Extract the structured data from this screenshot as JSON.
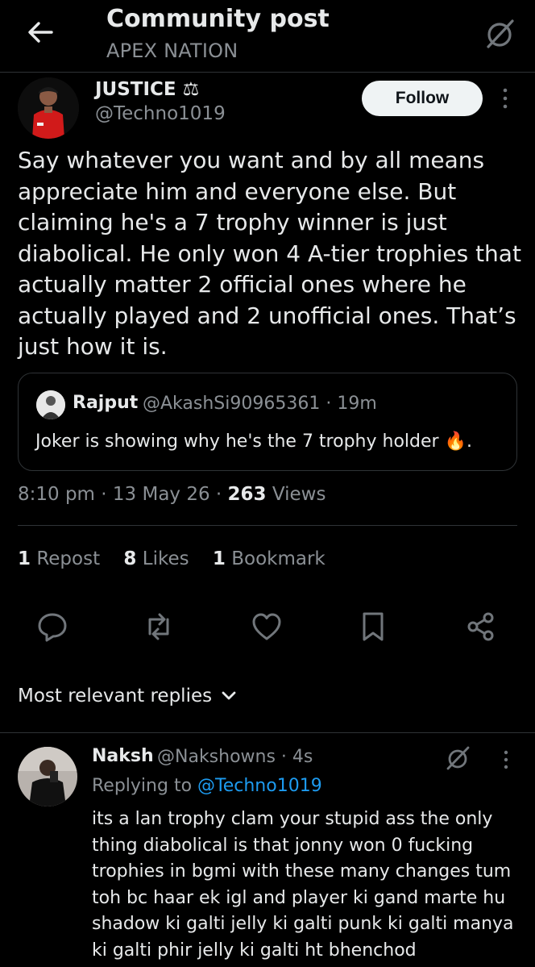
{
  "header": {
    "title": "Community post",
    "subtitle": "APEX NATION"
  },
  "post": {
    "author_name": "JUSTICE ⚖",
    "author_handle": "@Techno1019",
    "follow_label": "Follow",
    "text": "Say whatever you want and by all means appreciate him and everyone else. But claiming he's a 7 trophy winner is just diabolical. He only won 4 A-tier trophies that actually matter 2 official ones where he actually played and 2 unofficial ones. That’s just how it is.",
    "quote": {
      "name": "Rajput",
      "meta": "@AkashSi90965361 · 19m",
      "text": "Joker is showing why he's the 7 trophy holder 🔥."
    },
    "time": "8:10 pm · 13 May 26 · ",
    "views_count": "263",
    "views_label": " Views",
    "stats": {
      "reposts_count": "1",
      "reposts_label": " Repost",
      "likes_count": "8",
      "likes_label": " Likes",
      "bookmarks_count": "1",
      "bookmarks_label": " Bookmark"
    }
  },
  "replies_sort_label": "Most relevant replies",
  "reply": {
    "name": "Naksh",
    "meta": "@Nakshowns · 4s",
    "replying_prefix": "Replying to ",
    "replying_handle": "@Techno1019",
    "text": "its a lan trophy clam your stupid ass the only thing diabolical is that jonny won 0 fucking trophies in bgmi with these many changes tum toh bc haar ek igl and player ki gand marte hu shadow ki galti jelly ki galti punk ki galti manya ki galti phir jelly ki galti ht bhenchod"
  },
  "icons": {
    "back": "arrow-left-icon",
    "grok": "grok-icon",
    "more": "more-vertical-icon",
    "reply": "reply-icon",
    "repost": "repost-icon",
    "like": "heart-icon",
    "bookmark": "bookmark-icon",
    "share": "share-icon",
    "chevron": "chevron-down-icon"
  },
  "colors": {
    "background": "#000000",
    "text": "#e7e9ea",
    "muted": "#71767b",
    "link": "#1d9bf0",
    "follow_bg": "#eff3f4"
  }
}
